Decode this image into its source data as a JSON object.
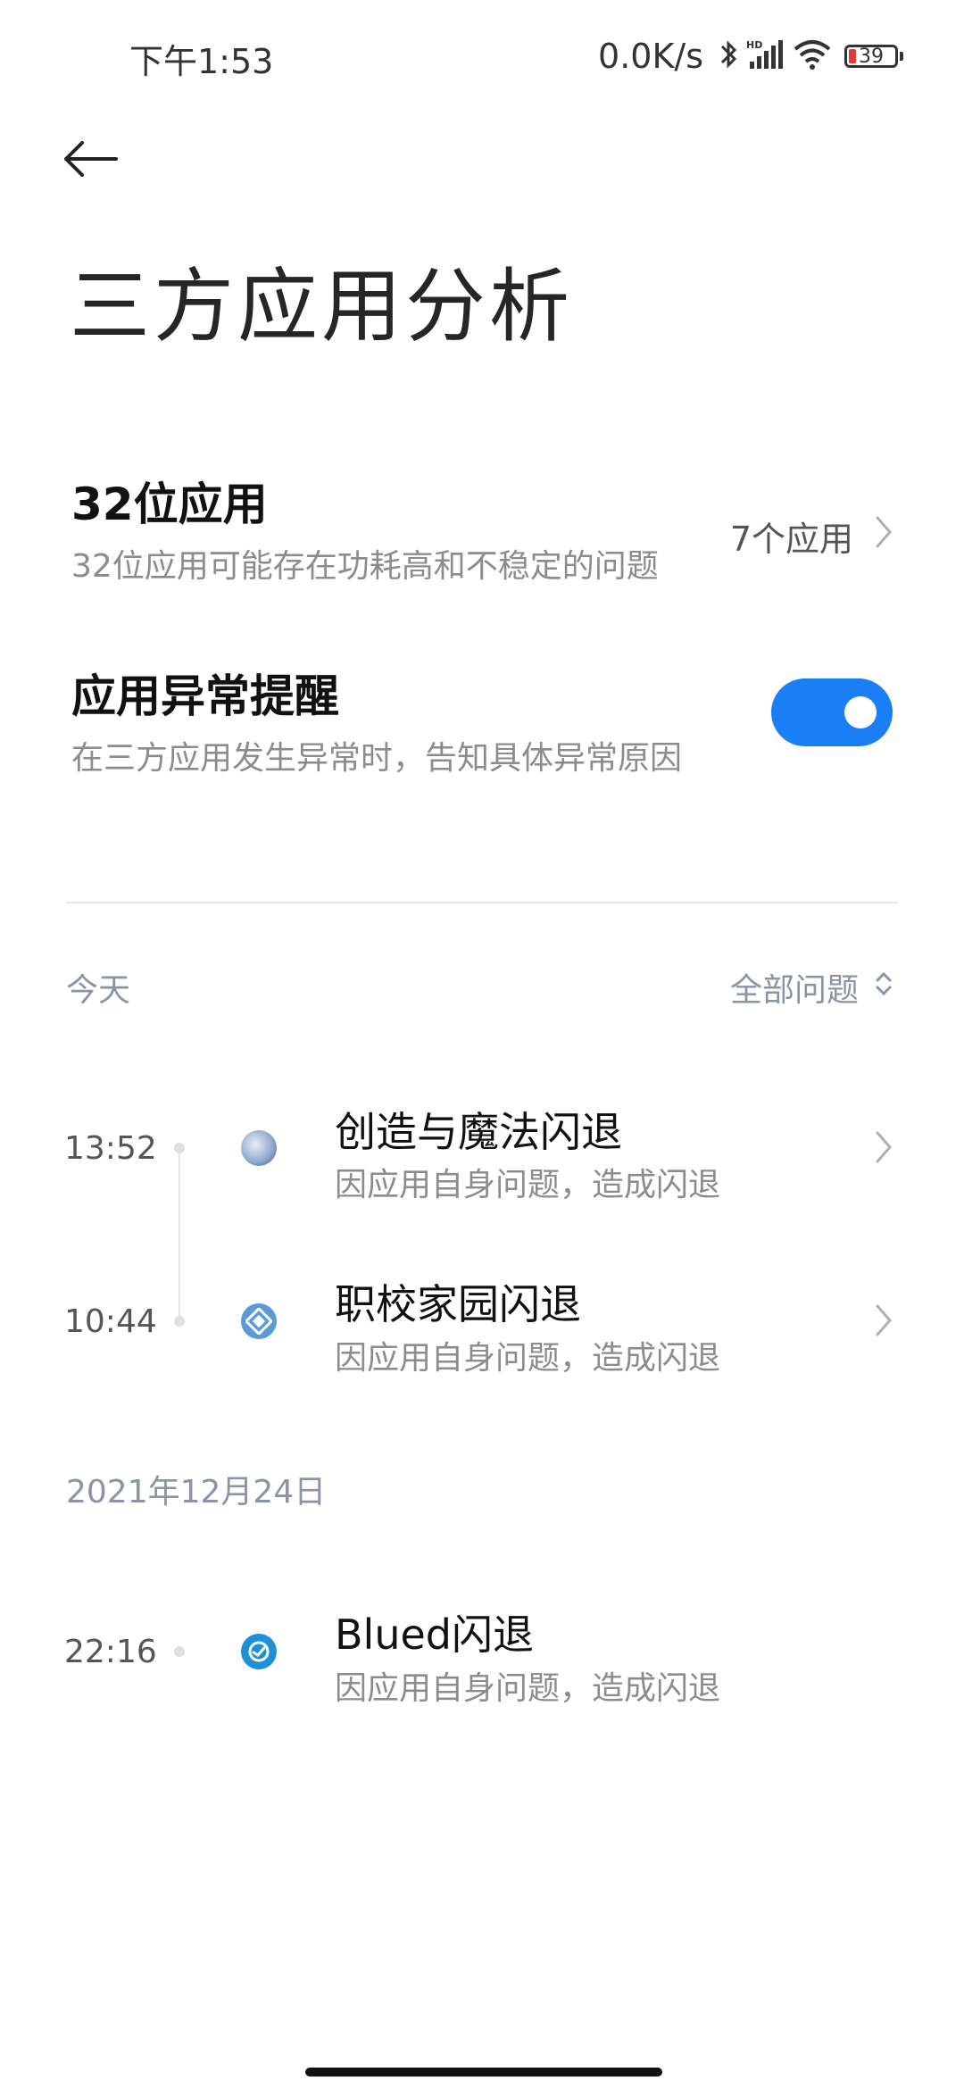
{
  "status_bar": {
    "time": "下午1:53",
    "net_speed": "0.0K/s",
    "battery_level": "39",
    "icons": [
      "bluetooth-icon",
      "hd-signal-icon",
      "wifi-icon",
      "battery-icon"
    ]
  },
  "header": {
    "back_icon": "arrow-left-icon",
    "title": "三方应用分析"
  },
  "settings": {
    "bit32": {
      "title": "32位应用",
      "description": "32位应用可能存在功耗高和不稳定的问题",
      "value": "7个应用"
    },
    "alert": {
      "title": "应用异常提醒",
      "description": "在三方应用发生异常时，告知具体异常原因",
      "enabled": true
    }
  },
  "filter": {
    "label": "全部问题"
  },
  "sections": [
    {
      "date_label": "今天",
      "items": [
        {
          "time": "13:52",
          "title": "创造与魔法闪退",
          "description": "因应用自身问题，造成闪退"
        },
        {
          "time": "10:44",
          "title": "职校家园闪退",
          "description": "因应用自身问题，造成闪退"
        }
      ]
    },
    {
      "date_label": "2021年12月24日",
      "items": [
        {
          "time": "22:16",
          "title": "Blued闪退",
          "description": "因应用自身问题，造成闪退"
        }
      ]
    }
  ],
  "colors": {
    "accent": "#1a7ff5",
    "section_label": "#8a93a8"
  }
}
